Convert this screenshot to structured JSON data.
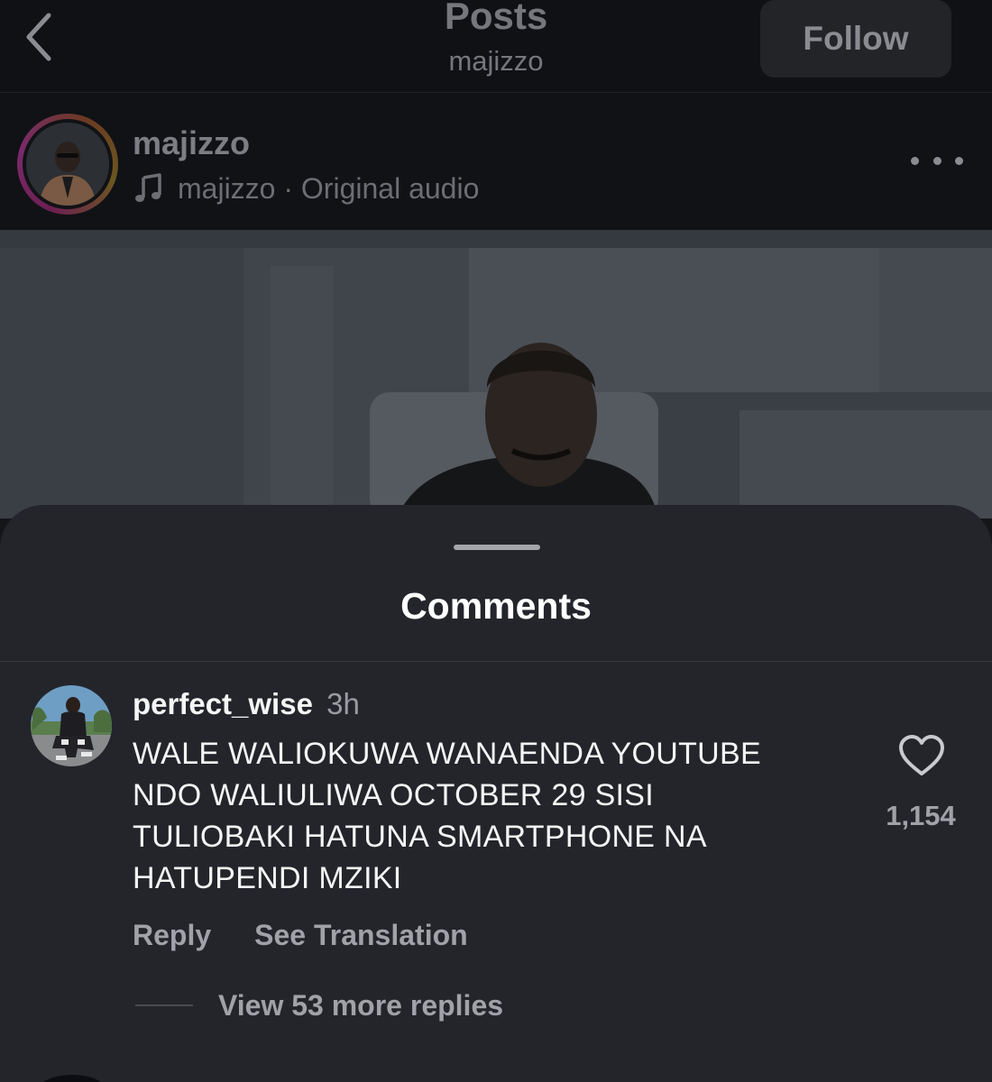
{
  "nav": {
    "title": "Posts",
    "subtitle": "majizzo",
    "follow_label": "Follow",
    "back_icon": "chevron-left-icon"
  },
  "post": {
    "author": "majizzo",
    "audio_owner": "majizzo",
    "audio_separator": " · ",
    "audio_label": "Original audio",
    "more_icon": "more-horizontal-icon",
    "audio_icon": "music-note-icon"
  },
  "comments_sheet": {
    "title": "Comments",
    "comments": [
      {
        "username": "perfect_wise",
        "time": "3h",
        "text_lines": [
          "WALE WALIOKUWA WANAENDA YOUTUBE",
          "NDO WALIULIWA OCTOBER 29 SISI",
          "TULIOBAKI HATUNA SMARTPHONE NA",
          "HATUPENDI MZIKI"
        ],
        "like_count": "1,154",
        "reply_label": "Reply",
        "translate_label": "See Translation",
        "view_replies_label": "View 53 more replies"
      }
    ]
  },
  "colors": {
    "sheet_bg": "#23252b",
    "topbar_bg": "#101115",
    "text_primary": "#f5f5f5",
    "text_secondary": "#a0a2a8"
  }
}
